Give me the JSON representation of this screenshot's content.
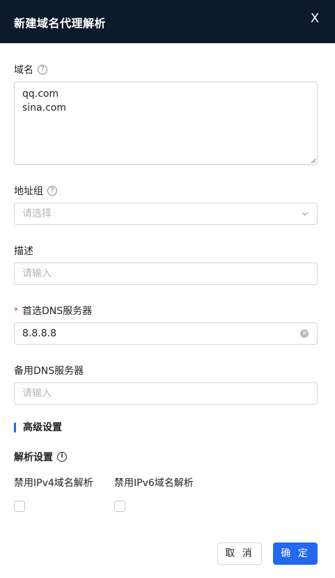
{
  "dialog": {
    "title": "新建域名代理解析",
    "close_glyph": "X"
  },
  "form": {
    "domain": {
      "label": "域名",
      "help_glyph": "?",
      "value": "qq.com\nsina.com"
    },
    "address_group": {
      "label": "地址组",
      "help_glyph": "?",
      "placeholder": "请选择"
    },
    "description": {
      "label": "描述",
      "placeholder": "请输入"
    },
    "primary_dns": {
      "required_mark": "*",
      "label": "首选DNS服务器",
      "value": "8.8.8.8"
    },
    "secondary_dns": {
      "label": "备用DNS服务器",
      "placeholder": "请输入"
    }
  },
  "advanced": {
    "section_title": "高级设置",
    "resolve_settings": {
      "label": "解析设置",
      "info_glyph": "i"
    },
    "options": [
      {
        "label": "禁用IPv4域名解析",
        "checked": false
      },
      {
        "label": "禁用IPv6域名解析",
        "checked": false
      }
    ]
  },
  "footer": {
    "cancel_label": "取 消",
    "ok_label": "确 定"
  },
  "colors": {
    "header_bg": "#0c1a2b",
    "accent": "#2568f0",
    "required": "#e0282e"
  }
}
